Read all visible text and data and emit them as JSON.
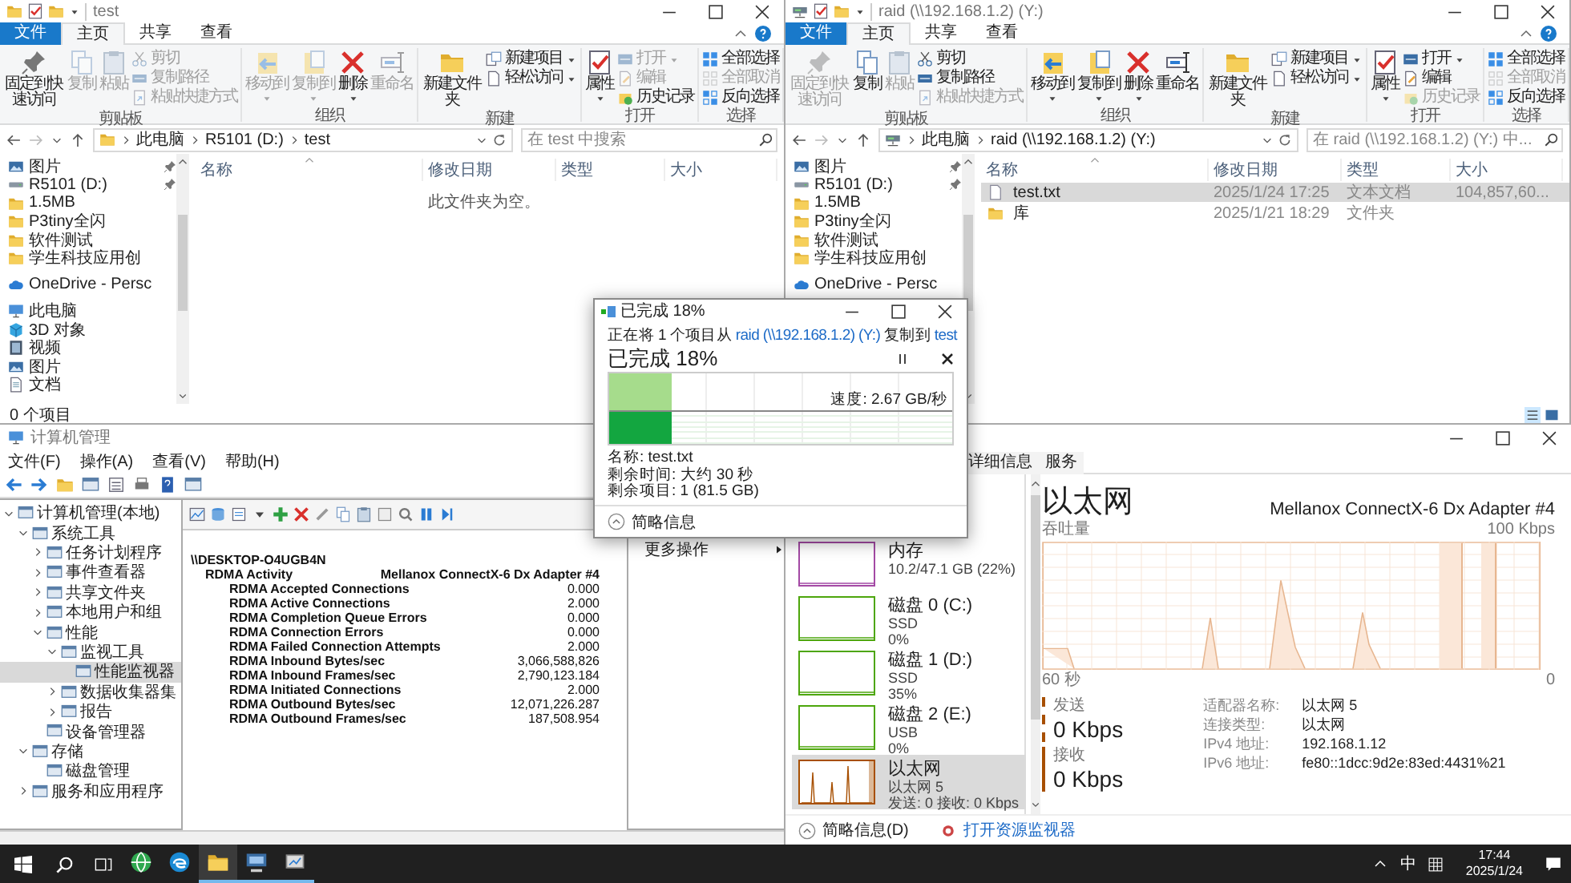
{
  "explorers": [
    {
      "title": "test",
      "nav": {
        "kind": "folder",
        "path": [
          "此电脑",
          "R5101 (D:)",
          "test"
        ],
        "placeholder": "在 test 中搜索"
      },
      "ribbon_tabs": [
        {
          "label": "文件",
          "kind": "file",
          "selected": false
        },
        {
          "label": "主页",
          "kind": "tab",
          "selected": true
        },
        {
          "label": "共享",
          "kind": "tab",
          "selected": false
        },
        {
          "label": "查看",
          "kind": "tab",
          "selected": false
        }
      ],
      "ribbon": [
        {
          "label": "剪贴板",
          "buttons": [
            {
              "label": "固定到快速访问",
              "kind": "large",
              "disabled": false,
              "menu": false
            },
            {
              "label": "复制",
              "kind": "large",
              "disabled": true,
              "menu": false
            },
            {
              "label": "粘贴",
              "kind": "large",
              "disabled": true,
              "menu": false
            },
            {
              "label": "剪切",
              "kind": "small",
              "disabled": true,
              "menu": false
            },
            {
              "label": "复制路径",
              "kind": "small",
              "disabled": true,
              "menu": false
            },
            {
              "label": "粘贴快捷方式",
              "kind": "small",
              "disabled": true,
              "menu": false
            }
          ]
        },
        {
          "label": "组织",
          "buttons": [
            {
              "label": "移动到",
              "kind": "large",
              "disabled": true,
              "menu": true
            },
            {
              "label": "复制到",
              "kind": "large",
              "disabled": true,
              "menu": true
            },
            {
              "label": "删除",
              "kind": "large",
              "disabled": false,
              "menu": true
            },
            {
              "label": "重命名",
              "kind": "large",
              "disabled": true,
              "menu": false
            }
          ]
        },
        {
          "label": "新建",
          "buttons": [
            {
              "label": "新建文件夹",
              "kind": "large",
              "disabled": false,
              "menu": false
            },
            {
              "label": "新建项目",
              "kind": "small",
              "disabled": false,
              "menu": true
            },
            {
              "label": "轻松访问",
              "kind": "small",
              "disabled": false,
              "menu": true
            }
          ]
        },
        {
          "label": "打开",
          "buttons": [
            {
              "label": "属性",
              "kind": "large",
              "disabled": false,
              "menu": true
            },
            {
              "label": "打开",
              "kind": "small",
              "disabled": true,
              "menu": true
            },
            {
              "label": "编辑",
              "kind": "small",
              "disabled": true,
              "menu": false
            },
            {
              "label": "历史记录",
              "kind": "small",
              "disabled": false,
              "menu": false
            }
          ]
        },
        {
          "label": "选择",
          "buttons": [
            {
              "label": "全部选择",
              "kind": "small",
              "disabled": false,
              "menu": false
            },
            {
              "label": "全部取消",
              "kind": "small",
              "disabled": true,
              "menu": false
            },
            {
              "label": "反向选择",
              "kind": "small",
              "disabled": false,
              "menu": false
            }
          ]
        }
      ],
      "sidebar": [
        {
          "label": "图片",
          "kind": "picture",
          "pinned": true
        },
        {
          "label": "R5101 (D:)",
          "kind": "drive",
          "pinned": true
        },
        {
          "label": "1.5MB",
          "kind": "folder",
          "pinned": false
        },
        {
          "label": "P3tiny全闪",
          "kind": "folder",
          "pinned": false
        },
        {
          "label": "软件测试",
          "kind": "folder",
          "pinned": false
        },
        {
          "label": "学生科技应用创",
          "kind": "folder",
          "pinned": false
        },
        {
          "label": "OneDrive - Persc",
          "kind": "cloud",
          "pinned": false
        },
        {
          "label": "此电脑",
          "kind": "pc",
          "pinned": false
        },
        {
          "label": "3D 对象",
          "kind": "object3d",
          "pinned": false
        },
        {
          "label": "视频",
          "kind": "video",
          "pinned": false
        },
        {
          "label": "图片",
          "kind": "picture",
          "pinned": false
        },
        {
          "label": "文档",
          "kind": "document",
          "pinned": false
        }
      ],
      "columns": [
        "名称",
        "修改日期",
        "类型",
        "大小"
      ],
      "empty_text": "此文件夹为空。",
      "status": "0 个项目"
    },
    {
      "title": "raid (\\\\192.168.1.2) (Y:)",
      "nav": {
        "kind": "netdrive",
        "path": [
          "此电脑",
          "raid (\\\\192.168.1.2) (Y:)"
        ],
        "placeholder": "在 raid (\\\\192.168.1.2) (Y:) 中..."
      },
      "ribbon_tabs": [
        {
          "label": "文件",
          "kind": "file",
          "selected": false
        },
        {
          "label": "主页",
          "kind": "tab",
          "selected": true
        },
        {
          "label": "共享",
          "kind": "tab",
          "selected": false
        },
        {
          "label": "查看",
          "kind": "tab",
          "selected": false
        }
      ],
      "ribbon": [
        {
          "label": "剪贴板",
          "buttons": [
            {
              "label": "固定到快速访问",
              "kind": "large",
              "disabled": true,
              "menu": false
            },
            {
              "label": "复制",
              "kind": "large",
              "disabled": false,
              "menu": false
            },
            {
              "label": "粘贴",
              "kind": "large",
              "disabled": true,
              "menu": false
            },
            {
              "label": "剪切",
              "kind": "small",
              "disabled": false,
              "menu": false
            },
            {
              "label": "复制路径",
              "kind": "small",
              "disabled": false,
              "menu": false
            },
            {
              "label": "粘贴快捷方式",
              "kind": "small",
              "disabled": true,
              "menu": false
            }
          ]
        },
        {
          "label": "组织",
          "buttons": [
            {
              "label": "移动到",
              "kind": "large",
              "disabled": false,
              "menu": true
            },
            {
              "label": "复制到",
              "kind": "large",
              "disabled": false,
              "menu": true
            },
            {
              "label": "删除",
              "kind": "large",
              "disabled": false,
              "menu": true
            },
            {
              "label": "重命名",
              "kind": "large",
              "disabled": false,
              "menu": false
            }
          ]
        },
        {
          "label": "新建",
          "buttons": [
            {
              "label": "新建文件夹",
              "kind": "large",
              "disabled": false,
              "menu": false
            },
            {
              "label": "新建项目",
              "kind": "small",
              "disabled": false,
              "menu": true
            },
            {
              "label": "轻松访问",
              "kind": "small",
              "disabled": false,
              "menu": true
            }
          ]
        },
        {
          "label": "打开",
          "buttons": [
            {
              "label": "属性",
              "kind": "large",
              "disabled": false,
              "menu": true
            },
            {
              "label": "打开",
              "kind": "small",
              "disabled": false,
              "menu": true
            },
            {
              "label": "编辑",
              "kind": "small",
              "disabled": false,
              "menu": false
            },
            {
              "label": "历史记录",
              "kind": "small",
              "disabled": true,
              "menu": false
            }
          ]
        },
        {
          "label": "选择",
          "buttons": [
            {
              "label": "全部选择",
              "kind": "small",
              "disabled": false,
              "menu": false
            },
            {
              "label": "全部取消",
              "kind": "small",
              "disabled": true,
              "menu": false
            },
            {
              "label": "反向选择",
              "kind": "small",
              "disabled": false,
              "menu": false
            }
          ]
        }
      ],
      "sidebar": [
        {
          "label": "图片",
          "kind": "picture",
          "pinned": true
        },
        {
          "label": "R5101 (D:)",
          "kind": "drive",
          "pinned": true
        },
        {
          "label": "1.5MB",
          "kind": "folder",
          "pinned": false
        },
        {
          "label": "P3tiny全闪",
          "kind": "folder",
          "pinned": false
        },
        {
          "label": "软件测试",
          "kind": "folder",
          "pinned": false
        },
        {
          "label": "学生科技应用创",
          "kind": "folder",
          "pinned": false
        },
        {
          "label": "OneDrive - Persc",
          "kind": "cloud",
          "pinned": false
        }
      ],
      "columns": [
        "名称",
        "修改日期",
        "类型",
        "大小"
      ],
      "rows": [
        {
          "kind": "file",
          "name": "test.txt",
          "date": "2025/1/24 17:25",
          "type": "文本文档",
          "size": "104,857,60...",
          "selected": true
        },
        {
          "kind": "folder",
          "name": "库",
          "date": "2025/1/21 18:29",
          "type": "文件夹",
          "size": "",
          "selected": false
        }
      ]
    }
  ],
  "computer_management": {
    "title": "计算机管理",
    "menu": [
      "文件(F)",
      "操作(A)",
      "查看(V)",
      "帮助(H)"
    ],
    "tree": [
      {
        "label": "计算机管理(本地)",
        "expanded": true,
        "selected": false,
        "children": [
          {
            "label": "系统工具",
            "expanded": true,
            "selected": false,
            "children": [
              {
                "label": "任务计划程序",
                "expanded": false,
                "selected": false
              },
              {
                "label": "事件查看器",
                "expanded": false,
                "selected": false
              },
              {
                "label": "共享文件夹",
                "expanded": false,
                "selected": false
              },
              {
                "label": "本地用户和组",
                "expanded": false,
                "selected": false
              },
              {
                "label": "性能",
                "expanded": true,
                "selected": false,
                "children": [
                  {
                    "label": "监视工具",
                    "expanded": true,
                    "selected": false,
                    "children": [
                      {
                        "label": "性能监视器",
                        "selected": true
                      }
                    ]
                  },
                  {
                    "label": "数据收集器集",
                    "expanded": false,
                    "selected": false
                  },
                  {
                    "label": "报告",
                    "expanded": false,
                    "selected": false
                  }
                ]
              },
              {
                "label": "设备管理器",
                "selected": false
              }
            ]
          },
          {
            "label": "存储",
            "expanded": true,
            "selected": false,
            "children": [
              {
                "label": "磁盘管理",
                "selected": false
              }
            ]
          },
          {
            "label": "服务和应用程序",
            "expanded": false,
            "selected": false
          }
        ]
      }
    ],
    "report": {
      "host": "\\\\DESKTOP-O4UGB4N",
      "object": "RDMA Activity",
      "instance": "Mellanox ConnectX-6 Dx Adapter #4",
      "counters": [
        {
          "name": "RDMA Accepted Connections",
          "value": "0.000"
        },
        {
          "name": "RDMA Active Connections",
          "value": "2.000"
        },
        {
          "name": "RDMA Completion Queue Errors",
          "value": "0.000"
        },
        {
          "name": "RDMA Connection Errors",
          "value": "0.000"
        },
        {
          "name": "RDMA Failed Connection Attempts",
          "value": "2.000"
        },
        {
          "name": "RDMA Inbound Bytes/sec",
          "value": "3,066,588,826"
        },
        {
          "name": "RDMA Inbound Frames/sec",
          "value": "2,790,123.184"
        },
        {
          "name": "RDMA Initiated Connections",
          "value": "2.000"
        },
        {
          "name": "RDMA Outbound Bytes/sec",
          "value": "12,071,226.287"
        },
        {
          "name": "RDMA Outbound Frames/sec",
          "value": "187,508.954"
        }
      ]
    },
    "actions": [
      "更多操作"
    ]
  },
  "task_manager": {
    "tabs": [
      {
        "label": "详细信息",
        "selected": false
      },
      {
        "label": "服务",
        "selected": false
      }
    ],
    "resources": [
      {
        "name": "内存",
        "lines": [
          "10.2/47.1 GB (22%)"
        ],
        "color": "#a349a4",
        "selected": false
      },
      {
        "name": "磁盘 0 (C:)",
        "lines": [
          "SSD",
          "0%"
        ],
        "color": "#4da60c",
        "selected": false
      },
      {
        "name": "磁盘 1 (D:)",
        "lines": [
          "SSD",
          "35%"
        ],
        "color": "#4da60c",
        "selected": false
      },
      {
        "name": "磁盘 2 (E:)",
        "lines": [
          "USB",
          "0%"
        ],
        "color": "#4da60c",
        "selected": false
      },
      {
        "name": "以太网",
        "lines": [
          "以太网 5",
          "发送: 0 接收: 0 Kbps"
        ],
        "color": "#a74f01",
        "selected": true
      }
    ],
    "detail": {
      "title": "以太网",
      "adapter": "Mellanox ConnectX-6 Dx Adapter #4",
      "graph_label": "吞吐量",
      "graph_max": "100 Kbps",
      "axis_start": "60 秒",
      "axis_end": "0",
      "send": {
        "label": "发送",
        "value": "0 Kbps"
      },
      "receive": {
        "label": "接收",
        "value": "0 Kbps"
      },
      "properties": [
        {
          "label": "适配器名称:",
          "value": "以太网 5"
        },
        {
          "label": "连接类型:",
          "value": "以太网"
        },
        {
          "label": "IPv4 地址:",
          "value": "192.168.1.12"
        },
        {
          "label": "IPv6 地址:",
          "value": "fe80::1dcc:9d2e:83ed:4431%21"
        }
      ]
    },
    "footer": {
      "less_details": "简略信息(D)",
      "resource_monitor": "打开资源监视器"
    }
  },
  "copy_dialog": {
    "title": "已完成 18%",
    "prefix": "正在将 1 个项目从",
    "source": "raid (\\\\192.168.1.2) (Y:)",
    "middle": "复制到",
    "destination": "test",
    "heading": "已完成 18%",
    "level": 0.18,
    "speed": "速度: 2.67 GB/秒",
    "details": [
      "名称: test.txt",
      "剩余时间: 大约 30 秒",
      "剩余项目: 1 (81.5 GB)"
    ],
    "less_details": "简略信息"
  },
  "taskbar": {
    "apps": [
      {
        "running": false,
        "active": false
      },
      {
        "running": false,
        "active": false
      },
      {
        "running": true,
        "active": true
      },
      {
        "running": true,
        "active": false
      },
      {
        "running": true,
        "active": false
      }
    ],
    "ime": "中",
    "time": "17:44",
    "date": "2025/1/24"
  }
}
